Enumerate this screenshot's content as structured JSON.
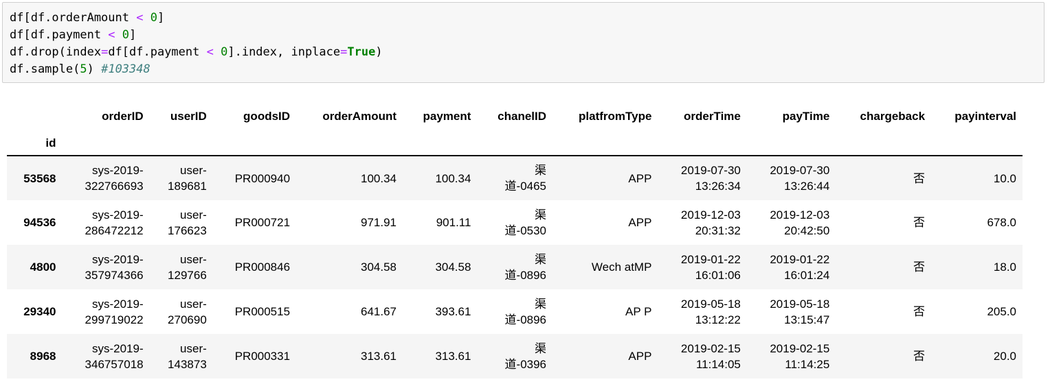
{
  "code_cell": {
    "lines": [
      [
        {
          "t": "df[df.orderAmount ",
          "c": ""
        },
        {
          "t": "<",
          "c": "op"
        },
        {
          "t": " ",
          "c": ""
        },
        {
          "t": "0",
          "c": "num"
        },
        {
          "t": "]",
          "c": ""
        }
      ],
      [
        {
          "t": "df[df.payment ",
          "c": ""
        },
        {
          "t": "<",
          "c": "op"
        },
        {
          "t": " ",
          "c": ""
        },
        {
          "t": "0",
          "c": "num"
        },
        {
          "t": "]",
          "c": ""
        }
      ],
      [
        {
          "t": "df.drop(index",
          "c": ""
        },
        {
          "t": "=",
          "c": "op"
        },
        {
          "t": "df[df.payment ",
          "c": ""
        },
        {
          "t": "<",
          "c": "op"
        },
        {
          "t": " ",
          "c": ""
        },
        {
          "t": "0",
          "c": "num"
        },
        {
          "t": "].index, inplace",
          "c": ""
        },
        {
          "t": "=",
          "c": "op"
        },
        {
          "t": "True",
          "c": "kw"
        },
        {
          "t": ")",
          "c": ""
        }
      ],
      [
        {
          "t": "df.sample(",
          "c": ""
        },
        {
          "t": "5",
          "c": "num"
        },
        {
          "t": ") ",
          "c": ""
        },
        {
          "t": "#103348",
          "c": "cmt"
        }
      ]
    ]
  },
  "table": {
    "columns": [
      "orderID",
      "userID",
      "goodsID",
      "orderAmount",
      "payment",
      "chanelID",
      "platfromType",
      "orderTime",
      "payTime",
      "chargeback",
      "payinterval"
    ],
    "index_name": "id",
    "rows": [
      {
        "id": "53568",
        "cells": [
          [
            "sys-2019-",
            "322766693"
          ],
          [
            "user-",
            "189681"
          ],
          [
            "PR000940"
          ],
          [
            "100.34"
          ],
          [
            "100.34"
          ],
          [
            "渠",
            "道-0465"
          ],
          [
            "APP"
          ],
          [
            "2019-07-30",
            "13:26:34"
          ],
          [
            "2019-07-30",
            "13:26:44"
          ],
          [
            "否"
          ],
          [
            "10.0"
          ]
        ]
      },
      {
        "id": "94536",
        "cells": [
          [
            "sys-2019-",
            "286472212"
          ],
          [
            "user-",
            "176623"
          ],
          [
            "PR000721"
          ],
          [
            "971.91"
          ],
          [
            "901.11"
          ],
          [
            "渠",
            "道-0530"
          ],
          [
            "APP"
          ],
          [
            "2019-12-03",
            "20:31:32"
          ],
          [
            "2019-12-03",
            "20:42:50"
          ],
          [
            "否"
          ],
          [
            "678.0"
          ]
        ]
      },
      {
        "id": "4800",
        "cells": [
          [
            "sys-2019-",
            "357974366"
          ],
          [
            "user-",
            "129766"
          ],
          [
            "PR000846"
          ],
          [
            "304.58"
          ],
          [
            "304.58"
          ],
          [
            "渠",
            "道-0896"
          ],
          [
            "Wech atMP"
          ],
          [
            "2019-01-22",
            "16:01:06"
          ],
          [
            "2019-01-22",
            "16:01:24"
          ],
          [
            "否"
          ],
          [
            "18.0"
          ]
        ]
      },
      {
        "id": "29340",
        "cells": [
          [
            "sys-2019-",
            "299719022"
          ],
          [
            "user-",
            "270690"
          ],
          [
            "PR000515"
          ],
          [
            "641.67"
          ],
          [
            "393.61"
          ],
          [
            "渠",
            "道-0896"
          ],
          [
            "AP P"
          ],
          [
            "2019-05-18",
            "13:12:22"
          ],
          [
            "2019-05-18",
            "13:15:47"
          ],
          [
            "否"
          ],
          [
            "205.0"
          ]
        ]
      },
      {
        "id": "8968",
        "cells": [
          [
            "sys-2019-",
            "346757018"
          ],
          [
            "user-",
            "143873"
          ],
          [
            "PR000331"
          ],
          [
            "313.61"
          ],
          [
            "313.61"
          ],
          [
            "渠",
            "道-0396"
          ],
          [
            "APP"
          ],
          [
            "2019-02-15",
            "11:14:05"
          ],
          [
            "2019-02-15",
            "11:14:25"
          ],
          [
            "否"
          ],
          [
            "20.0"
          ]
        ]
      }
    ]
  }
}
